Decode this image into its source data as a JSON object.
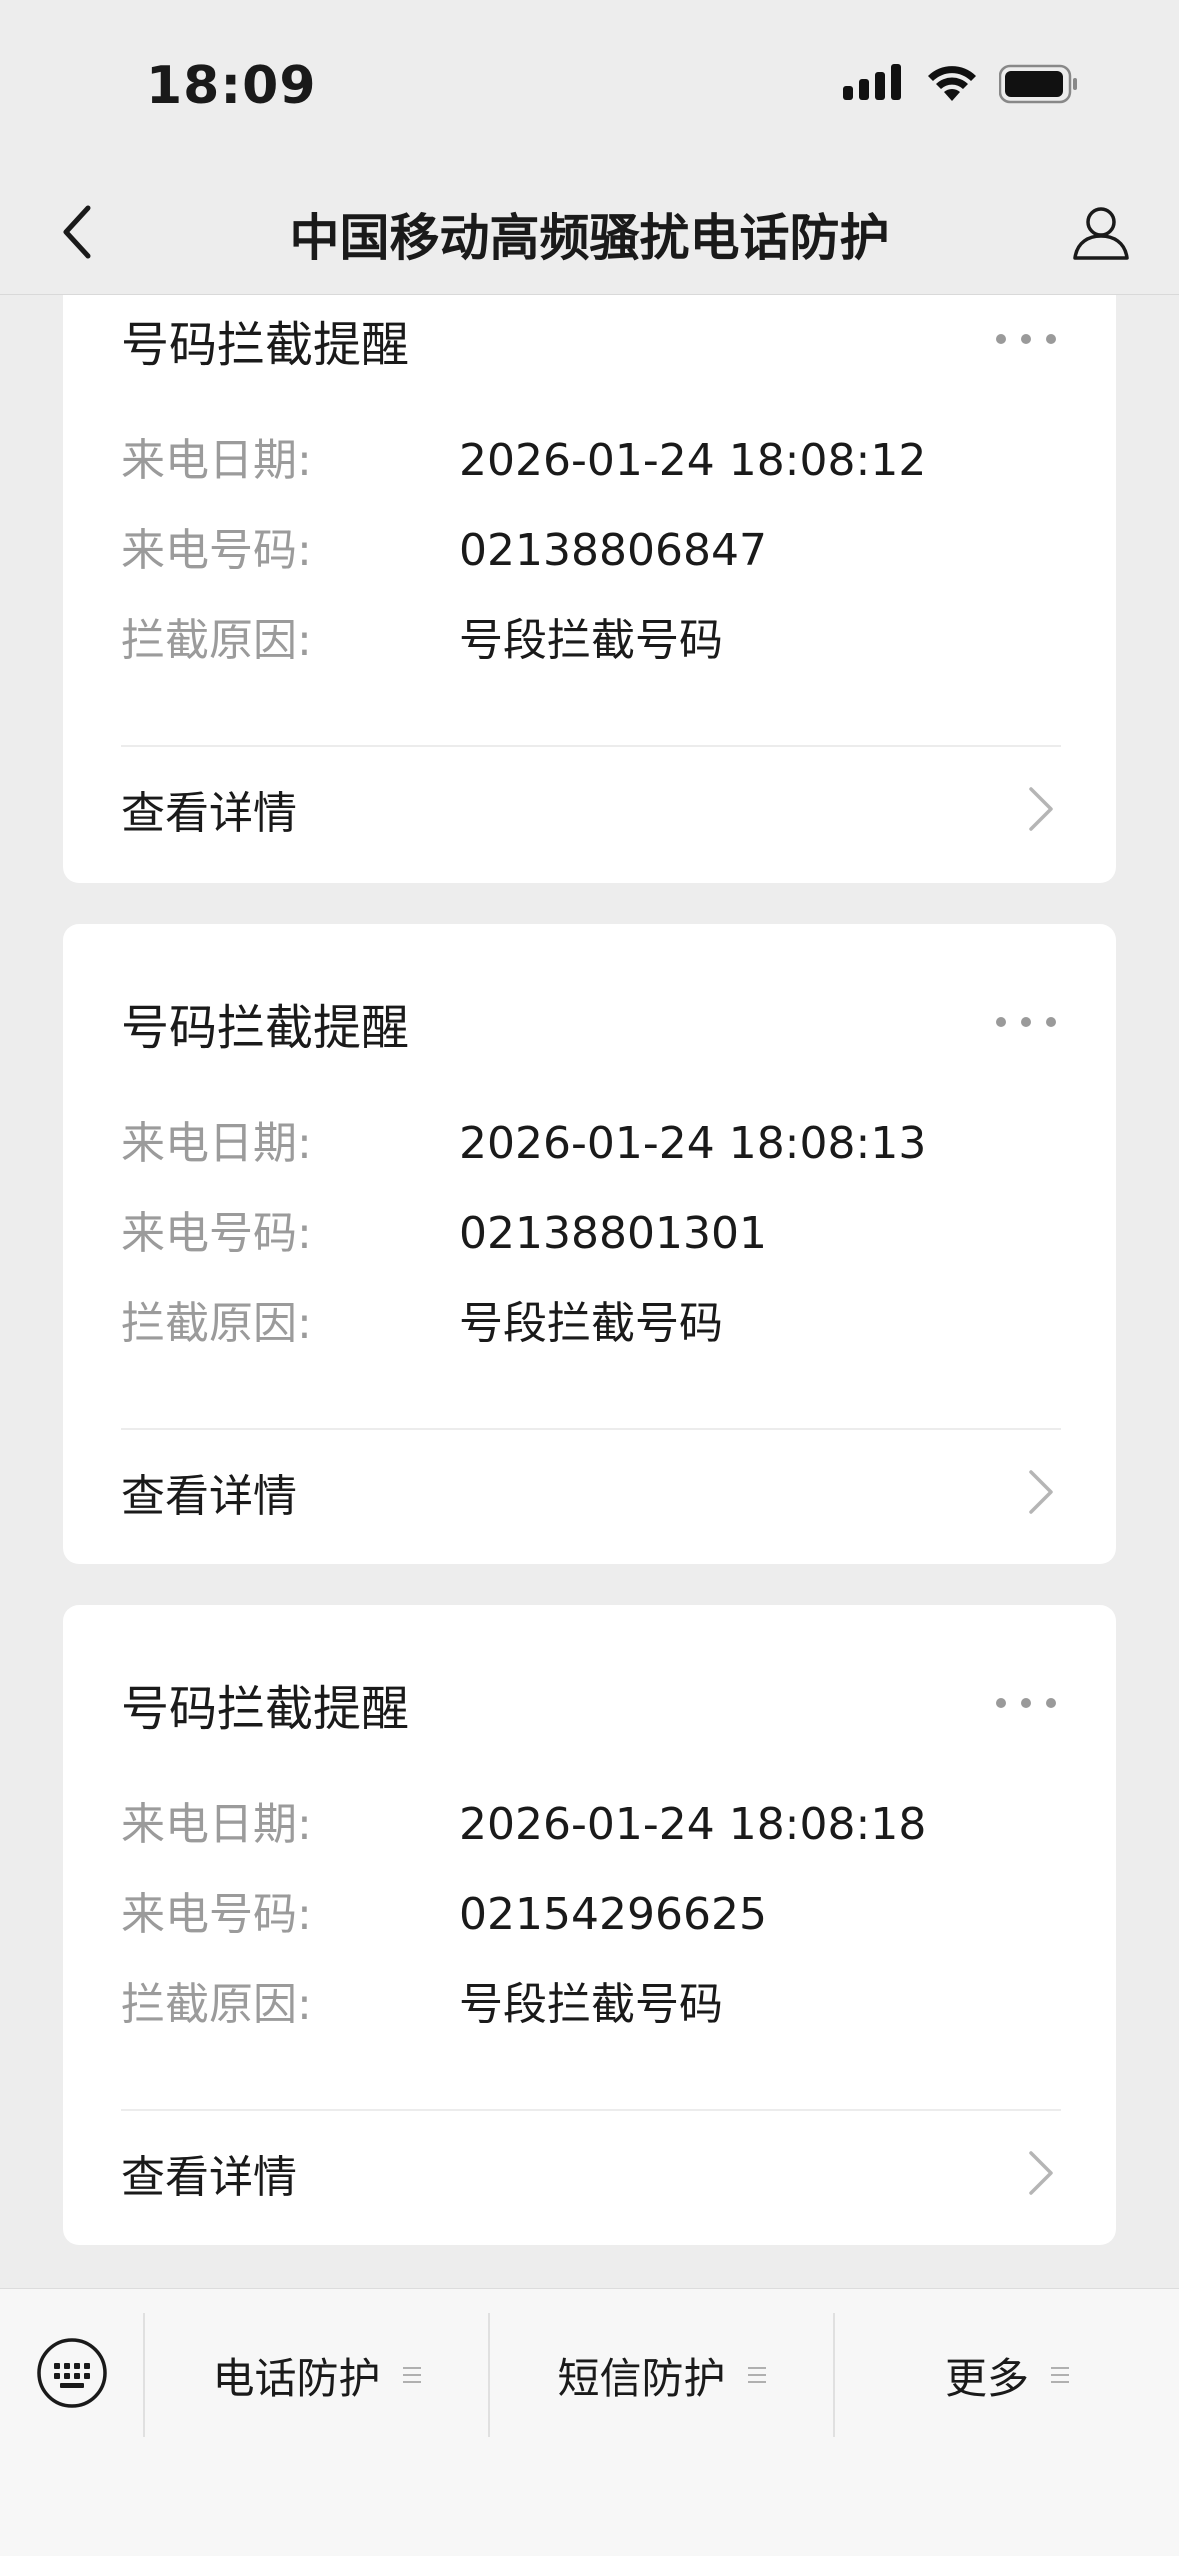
{
  "status_bar": {
    "time": "18:09"
  },
  "nav": {
    "title": "中国移动高频骚扰电话防护",
    "back_icon": "chevron-left-icon",
    "profile_icon": "person-icon"
  },
  "cards": [
    {
      "title": "号码拦截提醒",
      "rows": [
        {
          "label": "来电日期:",
          "value": "2026-01-24 18:08:12"
        },
        {
          "label": "来电号码:",
          "value": "02138806847"
        },
        {
          "label": "拦截原因:",
          "value": "号段拦截号码"
        }
      ],
      "detail_label": "查看详情"
    },
    {
      "title": "号码拦截提醒",
      "rows": [
        {
          "label": "来电日期:",
          "value": "2026-01-24 18:08:13"
        },
        {
          "label": "来电号码:",
          "value": "02138801301"
        },
        {
          "label": "拦截原因:",
          "value": "号段拦截号码"
        }
      ],
      "detail_label": "查看详情"
    },
    {
      "title": "号码拦截提醒",
      "rows": [
        {
          "label": "来电日期:",
          "value": "2026-01-24 18:08:18"
        },
        {
          "label": "来电号码:",
          "value": "02154296625"
        },
        {
          "label": "拦截原因:",
          "value": "号段拦截号码"
        }
      ],
      "detail_label": "查看详情"
    }
  ],
  "bottom_menu": {
    "keyboard_icon": "keyboard-icon",
    "items": [
      {
        "label": "电话防护"
      },
      {
        "label": "短信防护"
      },
      {
        "label": "更多"
      }
    ]
  },
  "colors": {
    "background": "#ededed",
    "card": "#ffffff",
    "label_gray": "#9b9b9b",
    "text": "#1a1a1a"
  }
}
